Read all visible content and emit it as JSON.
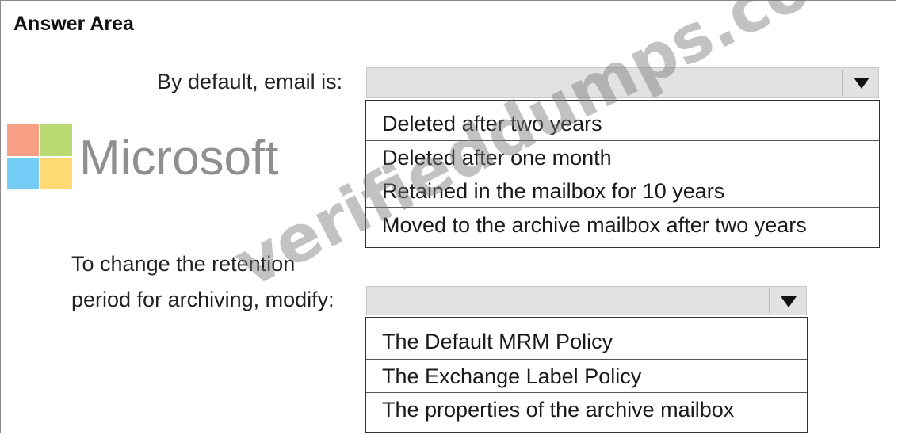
{
  "title": "Answer Area",
  "logo": {
    "word": "Microsoft",
    "colors": [
      "#f25022",
      "#7fba00",
      "#00a4ef",
      "#ffb900"
    ]
  },
  "watermark": "verifieddumps.com",
  "question1": {
    "label": "By default, email is:",
    "options": [
      "Deleted after two years",
      "Deleted after one month",
      "Retained in the mailbox for 10 years",
      "Moved to the archive mailbox after two years"
    ]
  },
  "question2": {
    "label_line1": "To change the retention",
    "label_line2": "period for archiving, modify:",
    "options": [
      "The Default MRM Policy",
      "The Exchange Label Policy",
      "The properties of the archive mailbox"
    ]
  }
}
